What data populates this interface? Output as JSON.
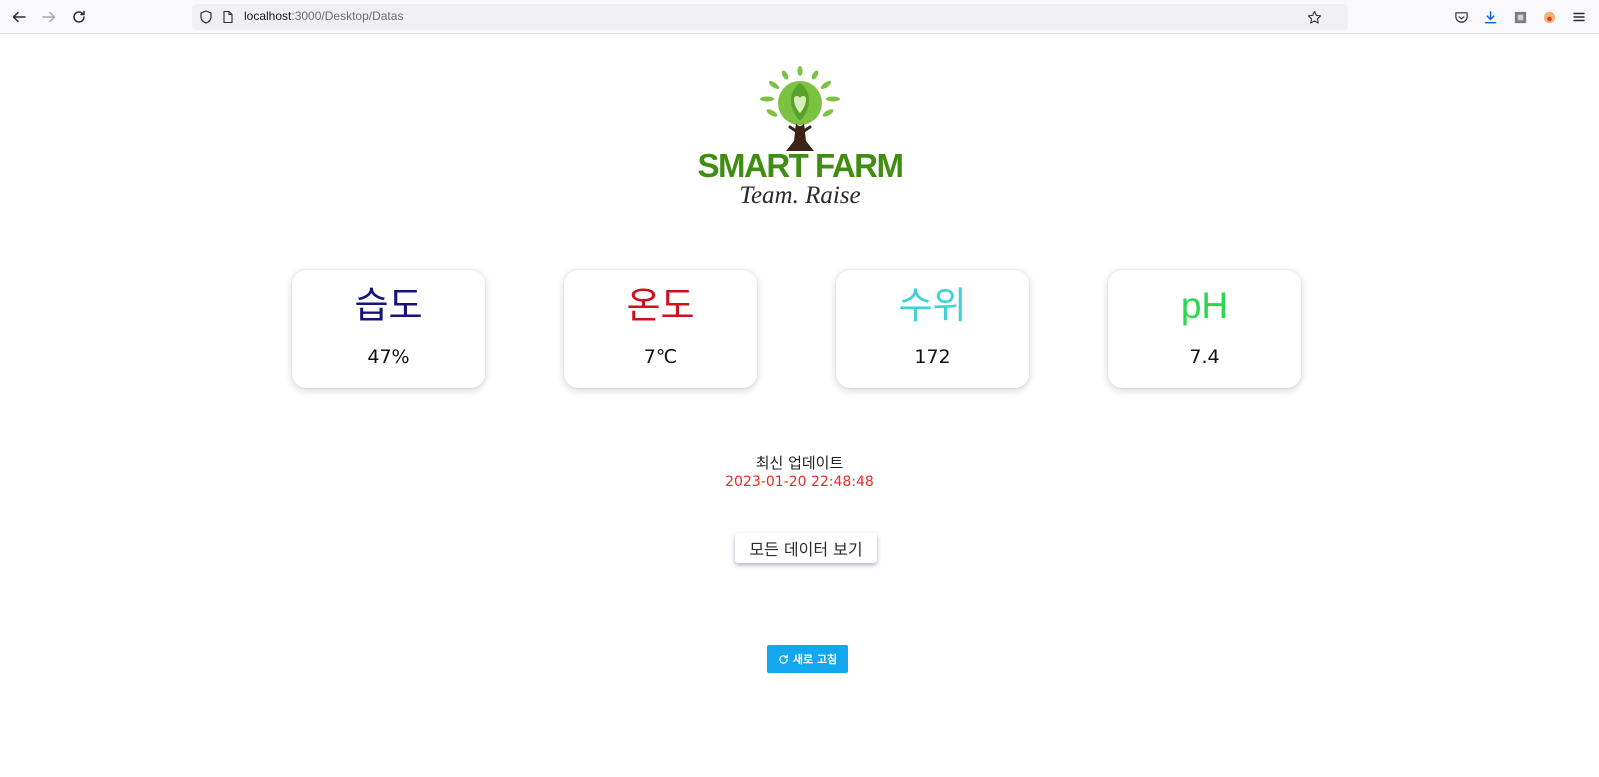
{
  "browser": {
    "url_host": "localhost",
    "url_path": ":3000/Desktop/Datas",
    "icons": [
      "back-icon",
      "forward-icon",
      "reload-icon",
      "shield-icon",
      "page-icon",
      "star-icon",
      "pocket-icon",
      "download-icon",
      "extension-icon",
      "profile-icon",
      "menu-icon"
    ]
  },
  "logo": {
    "brand": "SMART FARM",
    "team": "Team. Raise",
    "colors": {
      "brand": "#3f8e12",
      "leaf": "#7cc242",
      "trunk": "#3d2418"
    }
  },
  "cards": [
    {
      "title": "습도",
      "value": "47%",
      "color": "#16127a"
    },
    {
      "title": "온도",
      "value": "7℃",
      "color": "#d0101c"
    },
    {
      "title": "수위",
      "value": "172",
      "color": "#3ed2d8"
    },
    {
      "title": "pH",
      "value": "7.4",
      "color": "#2ad850"
    }
  ],
  "update": {
    "label": "최신 업데이트",
    "timestamp": "2023-01-20 22:48:48",
    "timestamp_color": "#ef2a2a"
  },
  "buttons": {
    "all_data_label": "모든 데이터 보기",
    "refresh_label": "새로 고침",
    "refresh_color": "#12a7ee"
  }
}
